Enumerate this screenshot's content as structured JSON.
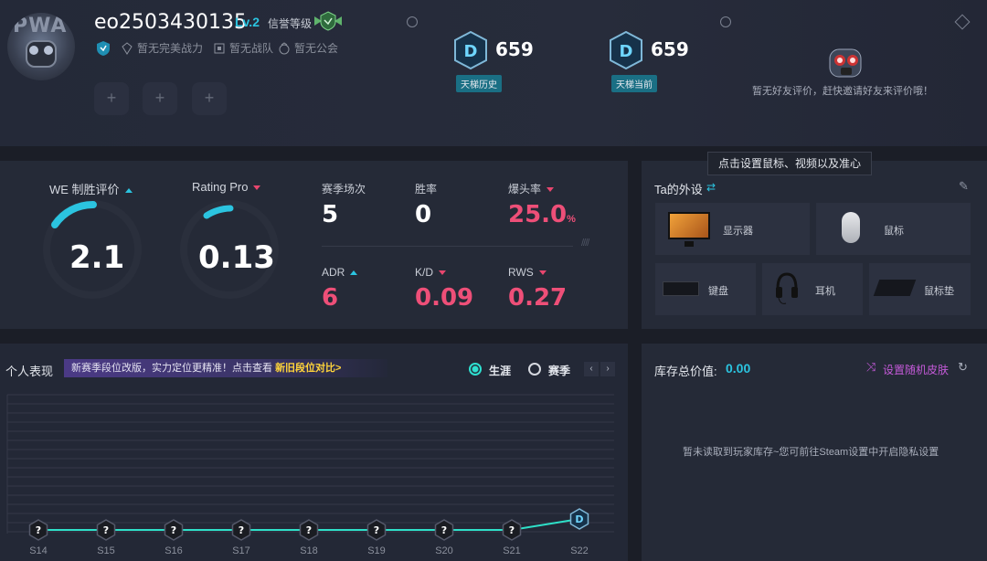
{
  "profile": {
    "avatar_text": "PWA",
    "username": "eo2503430135",
    "level": "Lv.2",
    "credit_label": "信誉等级",
    "tags": [
      "暂无完美战力",
      "暂无战队",
      "暂无公会"
    ],
    "slots": [
      "+",
      "+",
      "+"
    ]
  },
  "ladder": {
    "history": {
      "badge": "D",
      "score": "659",
      "label": "天梯历史"
    },
    "current": {
      "badge": "D",
      "score": "659",
      "label": "天梯当前"
    }
  },
  "friend_review": {
    "text": "暂无好友评价，赶快邀请好友来评价哦！"
  },
  "stats": {
    "we_label": "WE 制胜评价",
    "we_value": "2.1",
    "rating_label": "Rating Pro",
    "rating_value": "0.13",
    "matches_label": "赛季场次",
    "matches_value": "5",
    "winrate_label": "胜率",
    "winrate_value": "0",
    "hs_label": "爆头率",
    "hs_value": "25.0",
    "hs_unit": "%",
    "adr_label": "ADR",
    "adr_value": "6",
    "kd_label": "K/D",
    "kd_value": "0.09",
    "rws_label": "RWS",
    "rws_value": "0.27",
    "slashes": "////"
  },
  "equipment": {
    "title": "Ta的外设",
    "tooltip": "点击设置鼠标、视频以及准心",
    "monitor": "显示器",
    "mouse": "鼠标",
    "keyboard": "键盘",
    "headset": "耳机",
    "mousepad": "鼠标垫"
  },
  "performance": {
    "title": "个人表现",
    "banner_text": "新赛季段位改版，实力定位更精准！点击查看",
    "banner_link": "新旧段位对比>",
    "radio_career": "生涯",
    "radio_season": "赛季",
    "prev": "‹",
    "next": "›"
  },
  "chart_data": {
    "type": "line",
    "categories": [
      "S14",
      "S15",
      "S16",
      "S17",
      "S18",
      "S19",
      "S20",
      "S21",
      "S22"
    ],
    "markers": [
      "?",
      "?",
      "?",
      "?",
      "?",
      "?",
      "?",
      "?",
      "D"
    ],
    "series": [
      {
        "values": [
          0,
          0,
          0,
          0,
          0,
          0,
          0,
          0,
          1
        ]
      }
    ],
    "colors": {
      "line": "#2ee0c8",
      "grid": "#343948"
    },
    "grid": true
  },
  "inventory": {
    "label": "库存总价值:",
    "value": "0.00",
    "random_skin": "设置随机皮肤",
    "empty_text": "暂未读取到玩家库存~您可前往Steam设置中开启隐私设置"
  },
  "colors": {
    "cyan": "#2bc4e0",
    "pink": "#ee4f78",
    "yellow": "#ffd43a",
    "purple": "#c45ad8"
  }
}
